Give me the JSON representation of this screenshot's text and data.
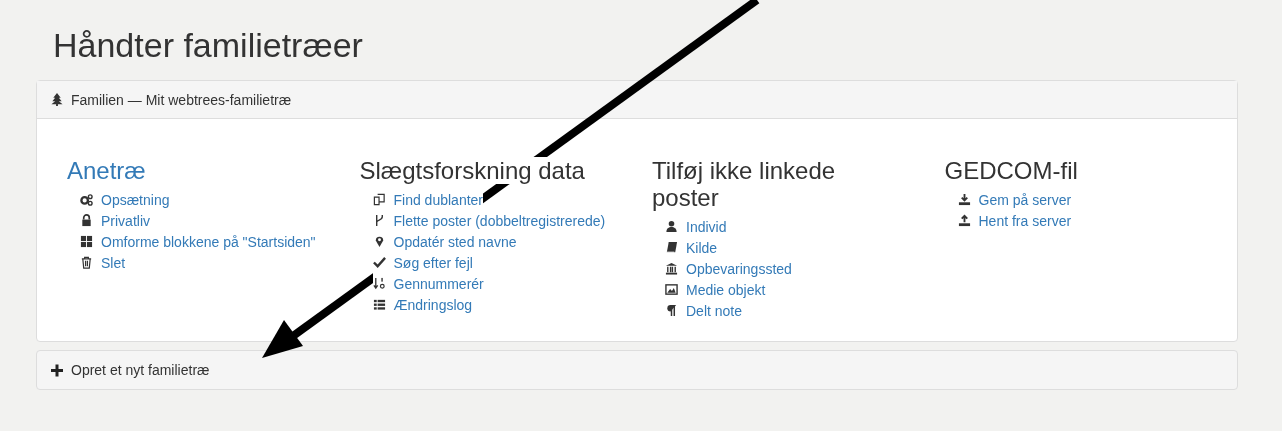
{
  "page_title": "Håndter familietræer",
  "tree_panel": {
    "title": "Familien — Mit webtrees-familietræ",
    "sections": [
      {
        "title": "Anetræ",
        "link": true,
        "items": [
          "Opsætning",
          "Privatliv",
          "Omforme blokkene på \"Startsiden\"",
          "Slet"
        ]
      },
      {
        "title": "Slægtsforskning data",
        "link": false,
        "items": [
          "Find dublanter",
          "Flette poster (dobbeltregistrerede)",
          "Opdatér sted navne",
          "Søg efter fejl",
          "Gennummerér",
          "Ændringslog"
        ]
      },
      {
        "title": "Tilføj ikke linkede poster",
        "link": false,
        "items": [
          "Individ",
          "Kilde",
          "Opbevaringssted",
          "Medie objekt",
          "Delt note"
        ]
      },
      {
        "title": "GEDCOM-fil",
        "link": false,
        "items": [
          "Gem på server",
          "Hent fra server"
        ]
      }
    ]
  },
  "create_panel": {
    "label": "Opret et nyt familietræ"
  }
}
